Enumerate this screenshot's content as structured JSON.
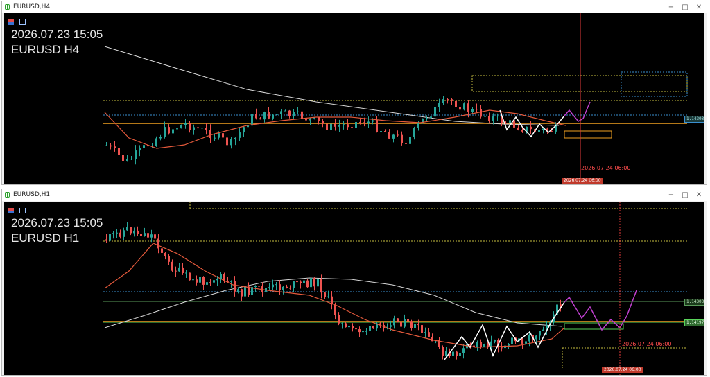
{
  "colors": {
    "background": "#000000",
    "bull_candle": "#26a69a",
    "bear_candle": "#ef5350",
    "ma_red": "#e55a3c",
    "ma_white": "#d8d8d8",
    "zigzag": "#ffffff",
    "forecast": "#c040d0",
    "level_orange": "#f0a020",
    "level_green": "#59d45a",
    "dotted_yellow": "#c8c040",
    "dotted_blue": "#3a8fd0",
    "vline_red": "#e03a3a"
  },
  "window_h4": {
    "title": "EURUSD,H4",
    "overlay_time": "2026.07.23 15:05",
    "overlay_symbol": "EURUSD H4",
    "price_tag": "1.14303",
    "vline_time_label": "2026.07.24 06:00",
    "vline_time_tag": "2026.07.24 06:00",
    "buttons": {
      "minimize": "−",
      "maximize": "□",
      "close": "✕"
    }
  },
  "window_h1": {
    "title": "EURUSD,H1",
    "overlay_time": "2026.07.23 15:05",
    "overlay_symbol": "EURUSD H1",
    "price_tag_upper": "1.14303",
    "price_tag_lower": "1.14197",
    "vline_time_label": "2026.07.24 06:00",
    "vline_time_tag": "2026.07.24 06:00",
    "buttons": {
      "minimize": "−",
      "maximize": "□",
      "close": "✕"
    }
  }
}
